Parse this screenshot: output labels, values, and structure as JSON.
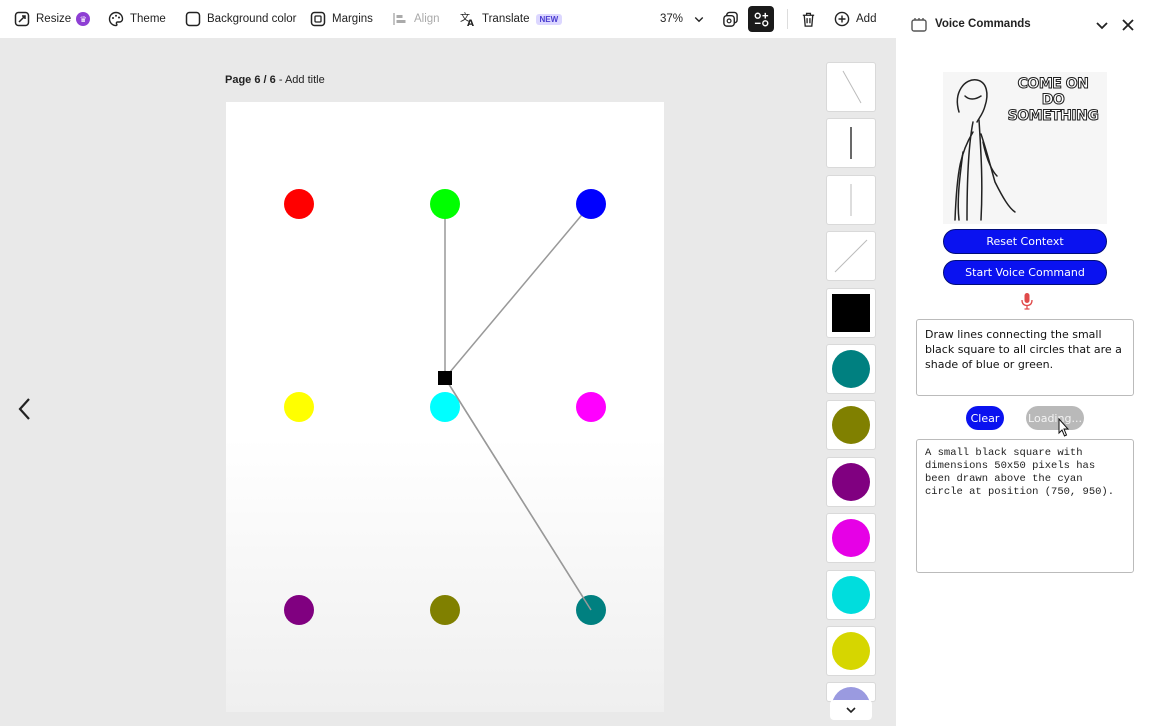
{
  "toolbar": {
    "resize": "Resize",
    "theme": "Theme",
    "background_color": "Background color",
    "margins": "Margins",
    "align": "Align",
    "translate": "Translate",
    "translate_badge": "NEW",
    "zoom": "37%",
    "add": "Add"
  },
  "canvas": {
    "page_number": "Page 6 / 6",
    "separator": " - ",
    "page_title_placeholder": "Add title",
    "circles": [
      {
        "color": "#ff0000"
      },
      {
        "color": "#00ff00"
      },
      {
        "color": "#0000ff"
      },
      {
        "color": "#ffff00"
      },
      {
        "color": "#00ffff"
      },
      {
        "color": "#ff00ff"
      },
      {
        "color": "#800080"
      },
      {
        "color": "#808000"
      },
      {
        "color": "#008080"
      }
    ],
    "square_color": "#000000",
    "line_color": "#999999"
  },
  "shape_strip": {
    "items": [
      {
        "kind": "line-diagonal-down"
      },
      {
        "kind": "line-vertical-thick"
      },
      {
        "kind": "line-vertical-thin"
      },
      {
        "kind": "line-diagonal-up"
      },
      {
        "kind": "square",
        "color": "#000000"
      },
      {
        "kind": "circle",
        "color": "#008080"
      },
      {
        "kind": "circle",
        "color": "#808000"
      },
      {
        "kind": "circle",
        "color": "#800080"
      },
      {
        "kind": "circle",
        "color": "#e600e6"
      },
      {
        "kind": "circle",
        "color": "#00dddd"
      },
      {
        "kind": "circle",
        "color": "#d6d600"
      },
      {
        "kind": "circle",
        "color": "#9a9ae0"
      }
    ]
  },
  "panel": {
    "title": "Voice Commands",
    "meme_caption": "COME ON DO SOMETHING",
    "reset_button": "Reset Context",
    "start_button": "Start Voice Command",
    "prompt_text": "Draw lines connecting the small black square to all circles that are a shade of blue or green.",
    "clear_button": "Clear",
    "loading_button": "Loading...",
    "output_text": "A small black square with dimensions 50x50 pixels has been drawn above the cyan circle at position (750, 950).",
    "accent_color": "#0a12f0"
  }
}
